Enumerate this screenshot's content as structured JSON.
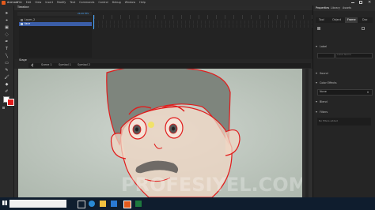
{
  "app": {
    "name": "Animate",
    "menu": [
      "File",
      "Edit",
      "View",
      "Insert",
      "Modify",
      "Text",
      "Commands",
      "Control",
      "Debug",
      "Window",
      "Help"
    ]
  },
  "timeline": {
    "tab_label": "Timeline",
    "frame_rate": "24.00 FPS",
    "layers": [
      {
        "name": "Layer_2"
      },
      {
        "name": "face"
      }
    ]
  },
  "stage": {
    "panel_title": "Stage",
    "breadcrumbs": [
      "Scene 1",
      "Symbol 1",
      "Symbol 2"
    ]
  },
  "properties": {
    "tabs": [
      "Properties",
      "Library",
      "Assets"
    ],
    "sub_tabs": [
      "Tool",
      "Object",
      "Frame",
      "Doc"
    ],
    "label_section": "Label",
    "label_name_placeholder": "Label Name",
    "sound_section": "Sound",
    "color_effects_section": "Color Effects",
    "color_effect_value": "None",
    "blend_section": "Blend",
    "filters_section": "Filters",
    "filters_empty": "No filters added"
  },
  "watermark": "PROFESIYEL.COM",
  "colors": {
    "accent": "#e11c1c",
    "stage_bg": "#bfc8c0",
    "face_fill": "#f0d7c4",
    "hair": "#7e857d"
  }
}
